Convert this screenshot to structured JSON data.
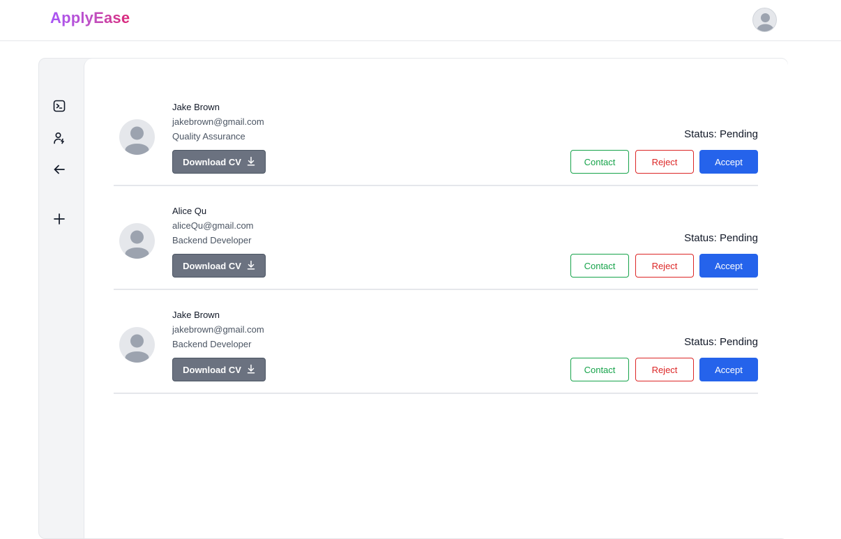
{
  "app": {
    "logo_text": "ApplyEase"
  },
  "header": {
    "avatar_icon": "user-avatar-icon"
  },
  "sidebar": {
    "items": [
      {
        "name": "terminal",
        "icon": "terminal-icon"
      },
      {
        "name": "user-add",
        "icon": "user-bolt-icon"
      },
      {
        "name": "back",
        "icon": "arrow-left-icon"
      },
      {
        "name": "add",
        "icon": "plus-icon"
      }
    ]
  },
  "applicants": [
    {
      "name": "Jake Brown",
      "email": "jakebrown@gmail.com",
      "role": "Quality Assurance",
      "download_label": "Download CV",
      "status": "Status: Pending",
      "contact_label": "Contact",
      "reject_label": "Reject",
      "accept_label": "Accept"
    },
    {
      "name": "Alice Qu",
      "email": "aliceQu@gmail.com",
      "role": "Backend Developer",
      "download_label": "Download CV",
      "status": "Status: Pending",
      "contact_label": "Contact",
      "reject_label": "Reject",
      "accept_label": "Accept"
    },
    {
      "name": "Jake Brown",
      "email": "jakebrown@gmail.com",
      "role": "Backend Developer",
      "download_label": "Download CV",
      "status": "Status: Pending",
      "contact_label": "Contact",
      "reject_label": "Reject",
      "accept_label": "Accept"
    }
  ],
  "colors": {
    "logo_start": "#a855f7",
    "logo_end": "#db2777",
    "contact": "#16a34a",
    "reject": "#dc2626",
    "accept": "#2563eb",
    "download_bg": "#6b7280"
  }
}
